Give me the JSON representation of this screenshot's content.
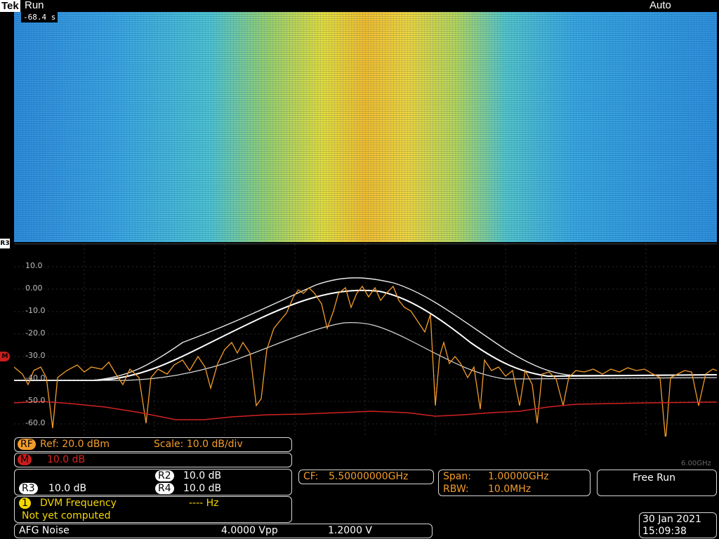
{
  "header": {
    "logo": "Tek",
    "run_state": "Run",
    "trigger_mode": "Auto",
    "time_offset": "-68.4 s"
  },
  "spectrum": {
    "ref_label": "R3",
    "y_labels": [
      "10.0",
      "0.00",
      "-10.0",
      "-20.0",
      "-30.0",
      "-40.0",
      "-50.0",
      "-60.0"
    ],
    "stop_freq": "6.00GHz",
    "m_marker": "M"
  },
  "rf_readout": {
    "badge": "RF",
    "ref": "Ref: 20.0 dBm",
    "scale": "Scale: 10.0 dB/div"
  },
  "math_readout": {
    "badge": "M",
    "value": "10.0 dB"
  },
  "ref_readouts": {
    "r2_badge": "R2",
    "r2_value": "10.0 dB",
    "r3_badge": "R3",
    "r3_value": "10.0 dB",
    "r4_badge": "R4",
    "r4_value": "10.0 dB"
  },
  "cf_readout": {
    "label": "CF:",
    "value": "5.50000000GHz"
  },
  "span_readout": {
    "span_label": "Span:",
    "span_value": "1.00000GHz",
    "rbw_label": "RBW:",
    "rbw_value": "10.0MHz"
  },
  "trigger_readout": {
    "value": "Free Run"
  },
  "dvm_readout": {
    "badge": "1",
    "title": "DVM Frequency",
    "value": "---- Hz",
    "status": "Not yet computed"
  },
  "afg_readout": {
    "label": "AFG Noise",
    "amplitude": "4.0000 Vpp",
    "offset": "1.2000 V"
  },
  "datetime": {
    "date": "30 Jan 2021",
    "time": "15:09:38"
  },
  "colors": {
    "rf": "#f39c2b",
    "math": "#d22222",
    "accent": "#f5d700"
  }
}
